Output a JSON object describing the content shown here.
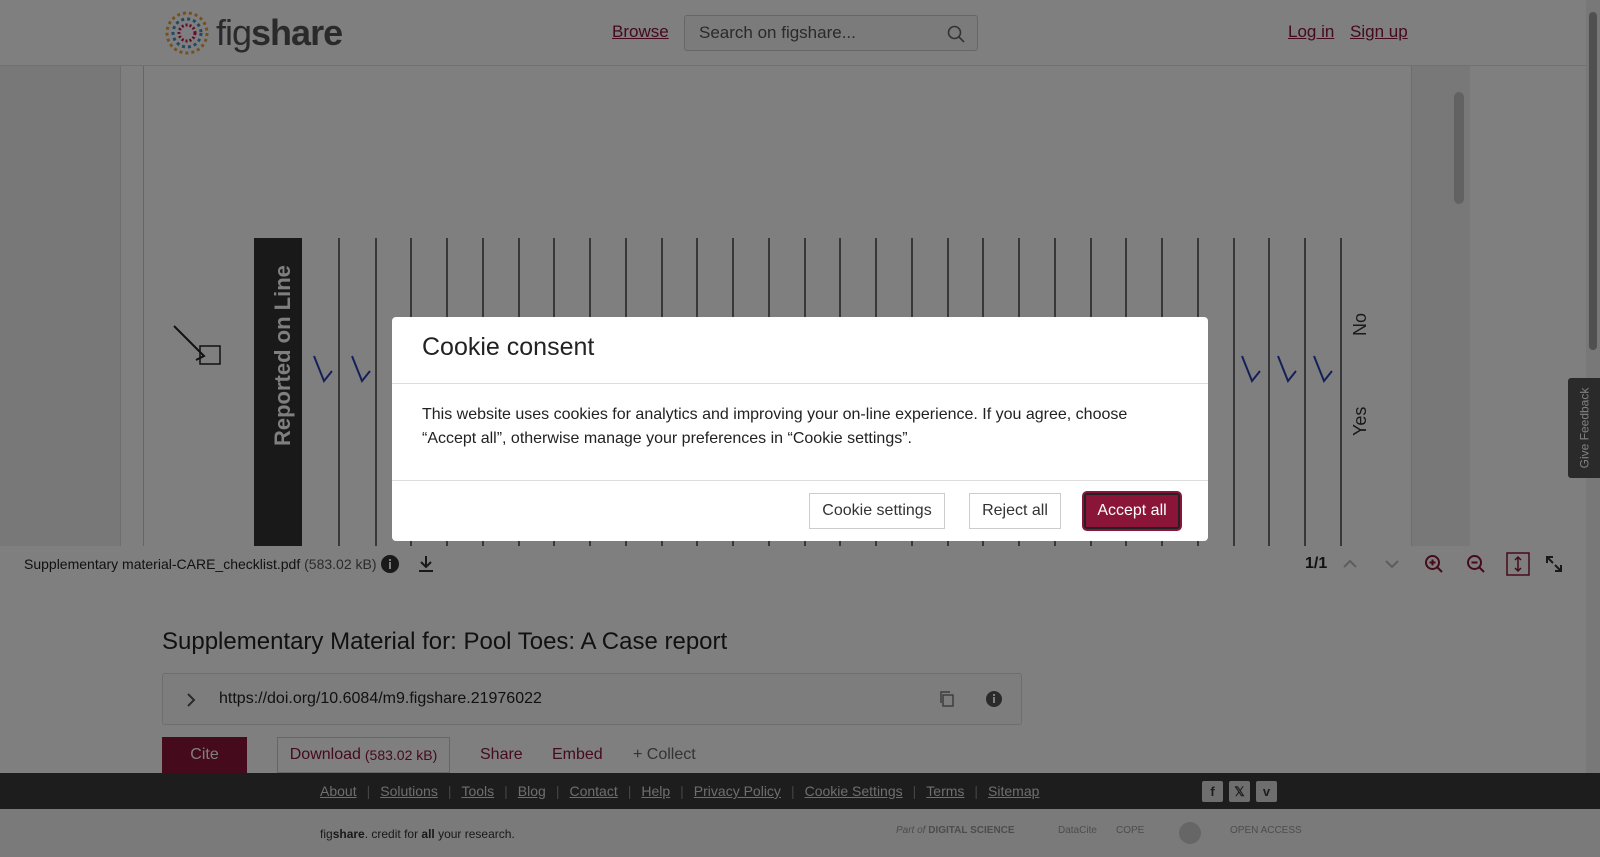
{
  "header": {
    "logo_text_a": "fig",
    "logo_text_b": "share",
    "browse_label": "Browse",
    "search_placeholder": "Search on figshare...",
    "login_label": "Log in",
    "signup_label": "Sign up"
  },
  "viewer": {
    "file_name": "Supplementary material-CARE_checklist.pdf",
    "file_size": "(583.02 kB)",
    "page_count": "1/1",
    "pdf_text": "Reported on Line",
    "pdf_side_a": "No",
    "pdf_side_b": "Yes"
  },
  "item": {
    "title": "Supplementary Material for: Pool Toes: A Case report",
    "doi": "https://doi.org/10.6084/m9.figshare.21976022",
    "cite_label": "Cite",
    "download_label": "Download",
    "download_size": "(583.02 kB)",
    "share_label": "Share",
    "embed_label": "Embed",
    "collect_label": "+ Collect"
  },
  "footer": {
    "links": [
      "About",
      "Solutions",
      "Tools",
      "Blog",
      "Contact",
      "Help",
      "Privacy Policy",
      "Cookie Settings",
      "Terms",
      "Sitemap"
    ],
    "credit_a": "fig",
    "credit_b": "share",
    "credit_c": ". credit for ",
    "credit_d": "all",
    "credit_e": " your research.",
    "partner_part_of": "Part of",
    "partner_ds": "DIGITAL SCIENCE",
    "partner_datacite": "DataCite",
    "partner_cope": "COPE",
    "partner_oa": "OPEN ACCESS"
  },
  "feedback_label": "Give Feedback",
  "cookie": {
    "title": "Cookie consent",
    "body": "This website uses cookies for analytics and improving your on-line experience. If you agree, choose “Accept all”, otherwise manage your preferences in “Cookie settings”.",
    "settings_label": "Cookie settings",
    "reject_label": "Reject all",
    "accept_label": "Accept all"
  },
  "colors": {
    "brand": "#8a1538",
    "footer_bg": "#3a3a3a"
  }
}
